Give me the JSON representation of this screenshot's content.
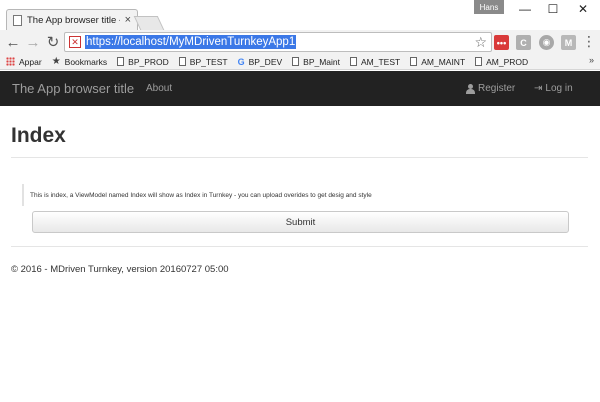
{
  "browser": {
    "tab_title": "The App browser title - M",
    "tab_close": "×",
    "profile_name": "Hans",
    "window": {
      "minimize": "—",
      "maximize": "☐",
      "close": "✕"
    },
    "address": "https://localhost/MyMDrivenTurnkeyApp1",
    "security_mark": "✕",
    "extensions": [
      "•••",
      "C",
      "◉",
      "M"
    ],
    "bookmarks": {
      "apps_label": "Appar",
      "bookmarks_label": "Bookmarks",
      "items": [
        "BP_PROD",
        "BP_TEST",
        "BP_DEV",
        "BP_Maint",
        "AM_TEST",
        "AM_MAINT",
        "AM_PROD"
      ],
      "more": "»"
    }
  },
  "navbar": {
    "brand": "The App browser title",
    "about": "About",
    "register": "Register",
    "login": "Log in"
  },
  "page": {
    "title": "Index",
    "note": "This is index, a ViewModel named Index will show as Index in Turnkey - you can upload overides to get desig and style",
    "submit_label": "Submit",
    "footer": "© 2016 - MDriven Turnkey, version 20160727 05:00"
  },
  "colors": {
    "navbar_bg": "#222222",
    "navbar_text": "#9d9d9d",
    "url_highlight": "#3b78e7"
  }
}
